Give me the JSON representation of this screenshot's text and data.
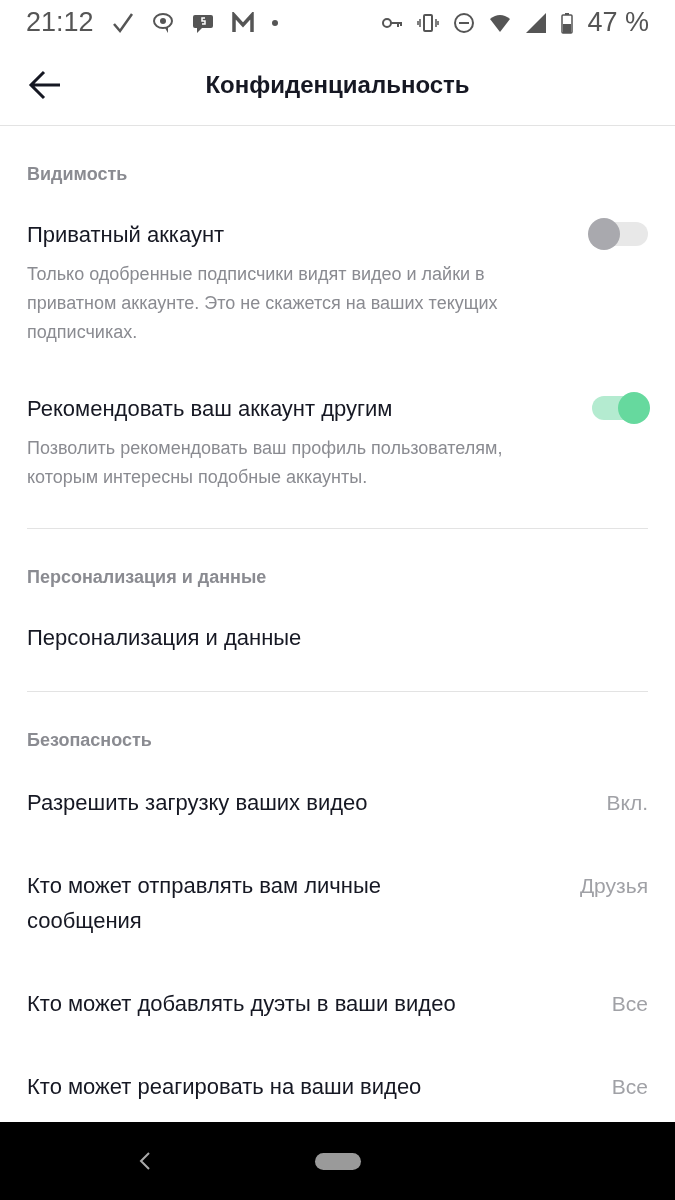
{
  "status_bar": {
    "time": "21:12",
    "battery": "47 %"
  },
  "header": {
    "title": "Конфиденциальность"
  },
  "sections": [
    {
      "title": "Видимость",
      "items": [
        {
          "kind": "toggle",
          "label": "Приватный аккаунт",
          "on": false,
          "description": "Только одобренные подписчики видят видео и лайки в приватном аккаунте. Это не скажется на ваших текущих подписчиках."
        },
        {
          "kind": "toggle",
          "label": "Рекомендовать ваш аккаунт другим",
          "on": true,
          "description": "Позволить рекомендовать ваш профиль пользователям, которым интересны подобные аккаунты."
        }
      ]
    },
    {
      "title": "Персонализация и данные",
      "items": [
        {
          "kind": "link",
          "label": "Персонализация и данные"
        }
      ]
    },
    {
      "title": "Безопасность",
      "items": [
        {
          "kind": "value",
          "label": "Разрешить загрузку ваших видео",
          "value": "Вкл."
        },
        {
          "kind": "value",
          "label": "Кто может отправлять вам личные сообщения",
          "value": "Друзья"
        },
        {
          "kind": "value",
          "label": "Кто может добавлять дуэты в ваши видео",
          "value": "Все"
        },
        {
          "kind": "value",
          "label": "Кто может реагировать на ваши видео",
          "value": "Все"
        }
      ]
    }
  ]
}
